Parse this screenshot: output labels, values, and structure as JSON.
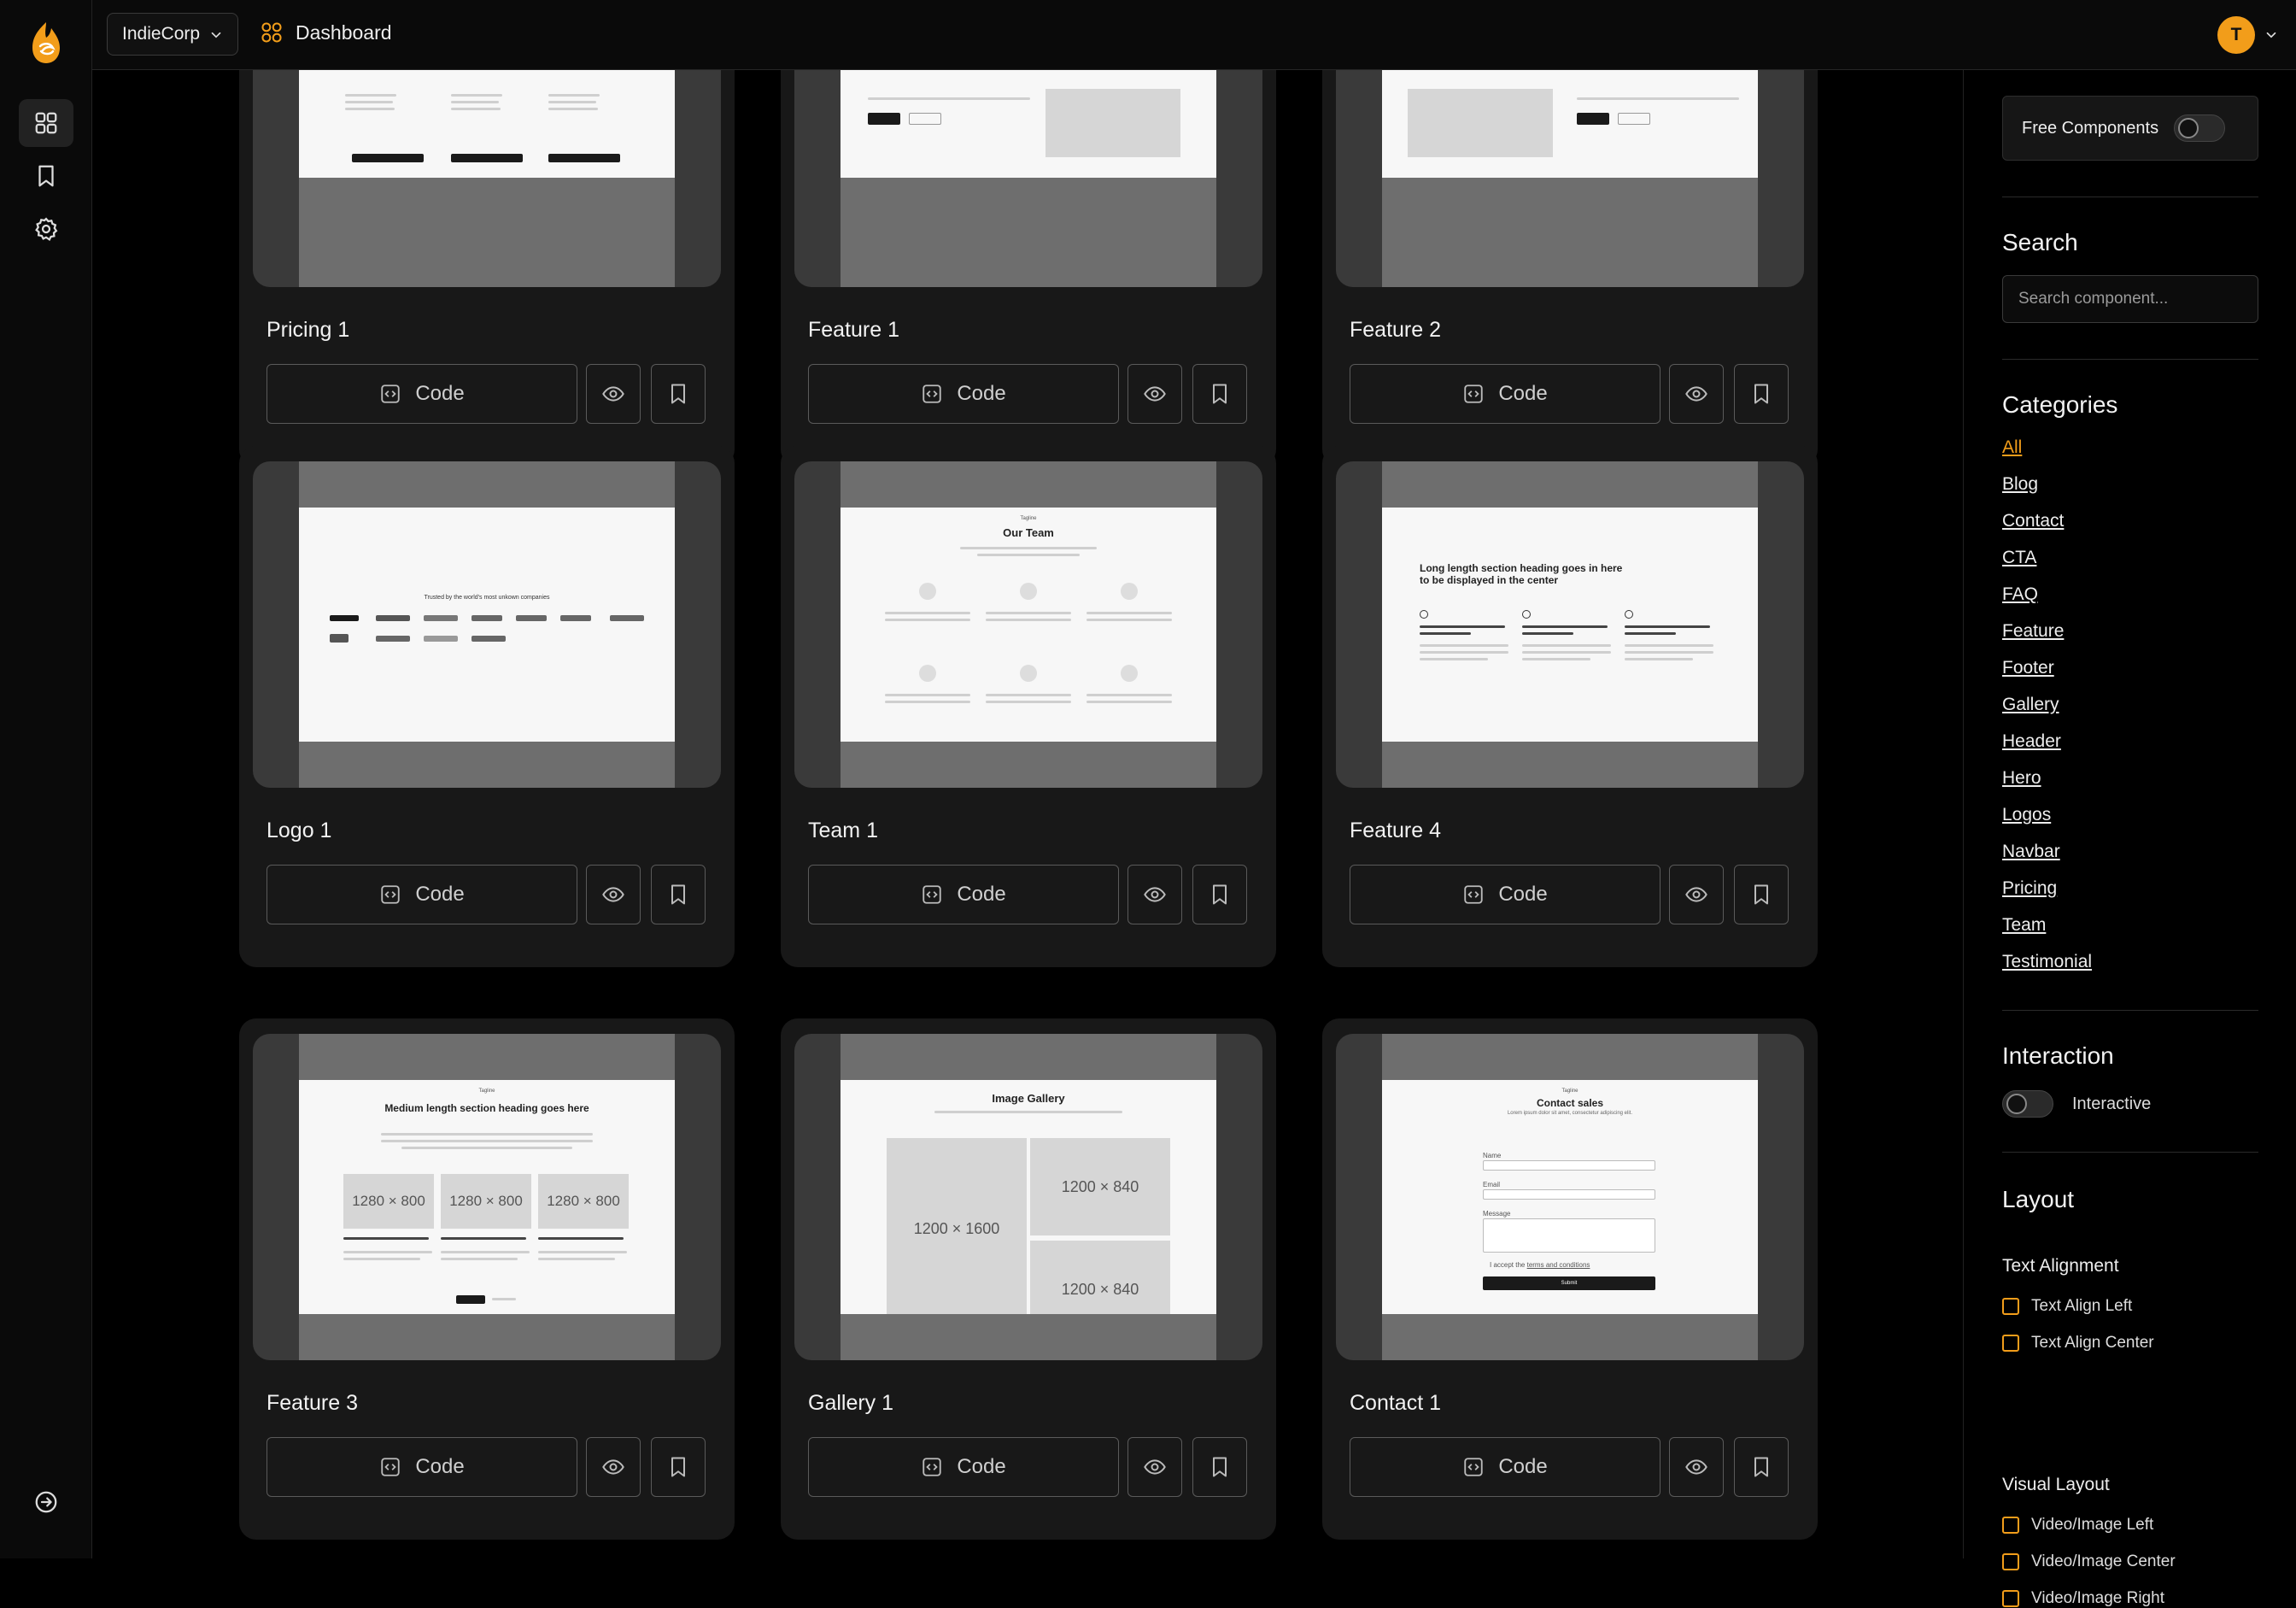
{
  "topbar": {
    "org_name": "IndieCorp",
    "breadcrumb": "Dashboard",
    "avatar_initial": "T"
  },
  "rail": {
    "items": [
      {
        "icon": "grid-icon",
        "active": true
      },
      {
        "icon": "bookmark-icon",
        "active": false
      },
      {
        "icon": "gear-icon",
        "active": false
      }
    ],
    "bottom_icon": "logout-icon"
  },
  "cards": [
    {
      "title": "Pricing 1",
      "code_label": "Code"
    },
    {
      "title": "Feature 1",
      "code_label": "Code"
    },
    {
      "title": "Feature 2",
      "code_label": "Code"
    },
    {
      "title": "Logo 1",
      "code_label": "Code"
    },
    {
      "title": "Team 1",
      "code_label": "Code"
    },
    {
      "title": "Feature 4",
      "code_label": "Code"
    },
    {
      "title": "Feature 3",
      "code_label": "Code"
    },
    {
      "title": "Gallery 1",
      "code_label": "Code"
    },
    {
      "title": "Contact 1",
      "code_label": "Code"
    }
  ],
  "previews": {
    "logo": {
      "heading": "Trusted by the world's most unkown companies"
    },
    "team": {
      "eyebrow": "Tagline",
      "heading": "Our Team"
    },
    "feature4": {
      "heading": "Long length section heading goes in here to be displayed in the center"
    },
    "feature3": {
      "eyebrow": "Tagline",
      "heading": "Medium length section heading goes here",
      "placeholders": [
        "1280 × 800",
        "1280 × 800",
        "1280 × 800"
      ]
    },
    "gallery": {
      "heading": "Image Gallery",
      "placeholders": [
        "1200 × 1600",
        "1200 × 840",
        "1200 × 840"
      ]
    },
    "contact": {
      "eyebrow": "Tagline",
      "heading": "Contact sales",
      "subheading": "Lorem ipsum dolor sit amet, consectetur adipiscing elit.",
      "fields": [
        "Name",
        "Email",
        "Message"
      ],
      "terms_text": "I accept the",
      "terms_link": "terms and conditions",
      "submit": "Submit"
    }
  },
  "panel": {
    "free_components_label": "Free Components",
    "search_heading": "Search",
    "search_placeholder": "Search component...",
    "categories_heading": "Categories",
    "categories": [
      "All",
      "Blog",
      "Contact",
      "CTA",
      "FAQ",
      "Feature",
      "Footer",
      "Gallery",
      "Header",
      "Hero",
      "Logos",
      "Navbar",
      "Pricing",
      "Team",
      "Testimonial"
    ],
    "active_category": "All",
    "interaction_heading": "Interaction",
    "interactive_label": "Interactive",
    "layout_heading": "Layout",
    "text_alignment_heading": "Text Alignment",
    "text_alignment_options": [
      "Text Align Left",
      "Text Align Center"
    ],
    "visual_layout_heading": "Visual Layout",
    "visual_layout_options": [
      "Video/Image Left",
      "Video/Image Center",
      "Video/Image Right"
    ]
  },
  "colors": {
    "accent": "#f29d1a",
    "background": "#000000",
    "card": "#181818"
  }
}
